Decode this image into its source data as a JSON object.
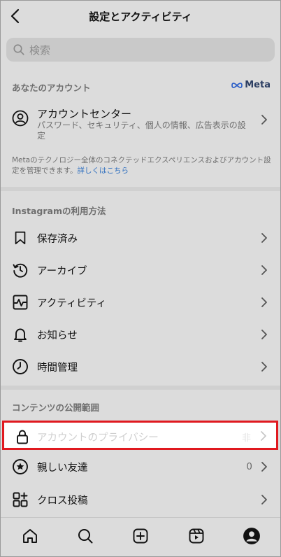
{
  "header": {
    "title": "設定とアクティビティ"
  },
  "search": {
    "placeholder": "検索"
  },
  "your_account": {
    "section_title": "あなたのアカウント",
    "brand": "Meta",
    "accounts_center": {
      "title": "アカウントセンター",
      "subtitle": "パスワード、セキュリティ、個人の情報、広告表示の設定"
    },
    "note_text": "Metaのテクノロジー全体のコネクテッドエクスペリエンスおよびアカウント設定を管理できます。",
    "note_link": "詳しくはこちら"
  },
  "how_to_use": {
    "section_title": "Instagramの利用方法",
    "items": [
      {
        "label": "保存済み",
        "icon": "bookmark-icon"
      },
      {
        "label": "アーカイブ",
        "icon": "archive-icon"
      },
      {
        "label": "アクティビティ",
        "icon": "activity-icon"
      },
      {
        "label": "お知らせ",
        "icon": "bell-icon"
      },
      {
        "label": "時間管理",
        "icon": "clock-icon"
      }
    ]
  },
  "visibility": {
    "section_title": "コンテンツの公開範囲",
    "items": [
      {
        "label": "アカウントのプライバシー",
        "icon": "lock-icon",
        "value": "非"
      },
      {
        "label": "親しい友達",
        "icon": "star-icon",
        "value": "0"
      },
      {
        "label": "クロス投稿",
        "icon": "cross-post-icon"
      }
    ]
  },
  "tabbar": {
    "items": [
      "home-icon",
      "search-icon",
      "create-icon",
      "reels-icon",
      "profile-icon"
    ]
  },
  "colors": {
    "highlight": "#e0191f",
    "link": "#2f6fbf"
  }
}
